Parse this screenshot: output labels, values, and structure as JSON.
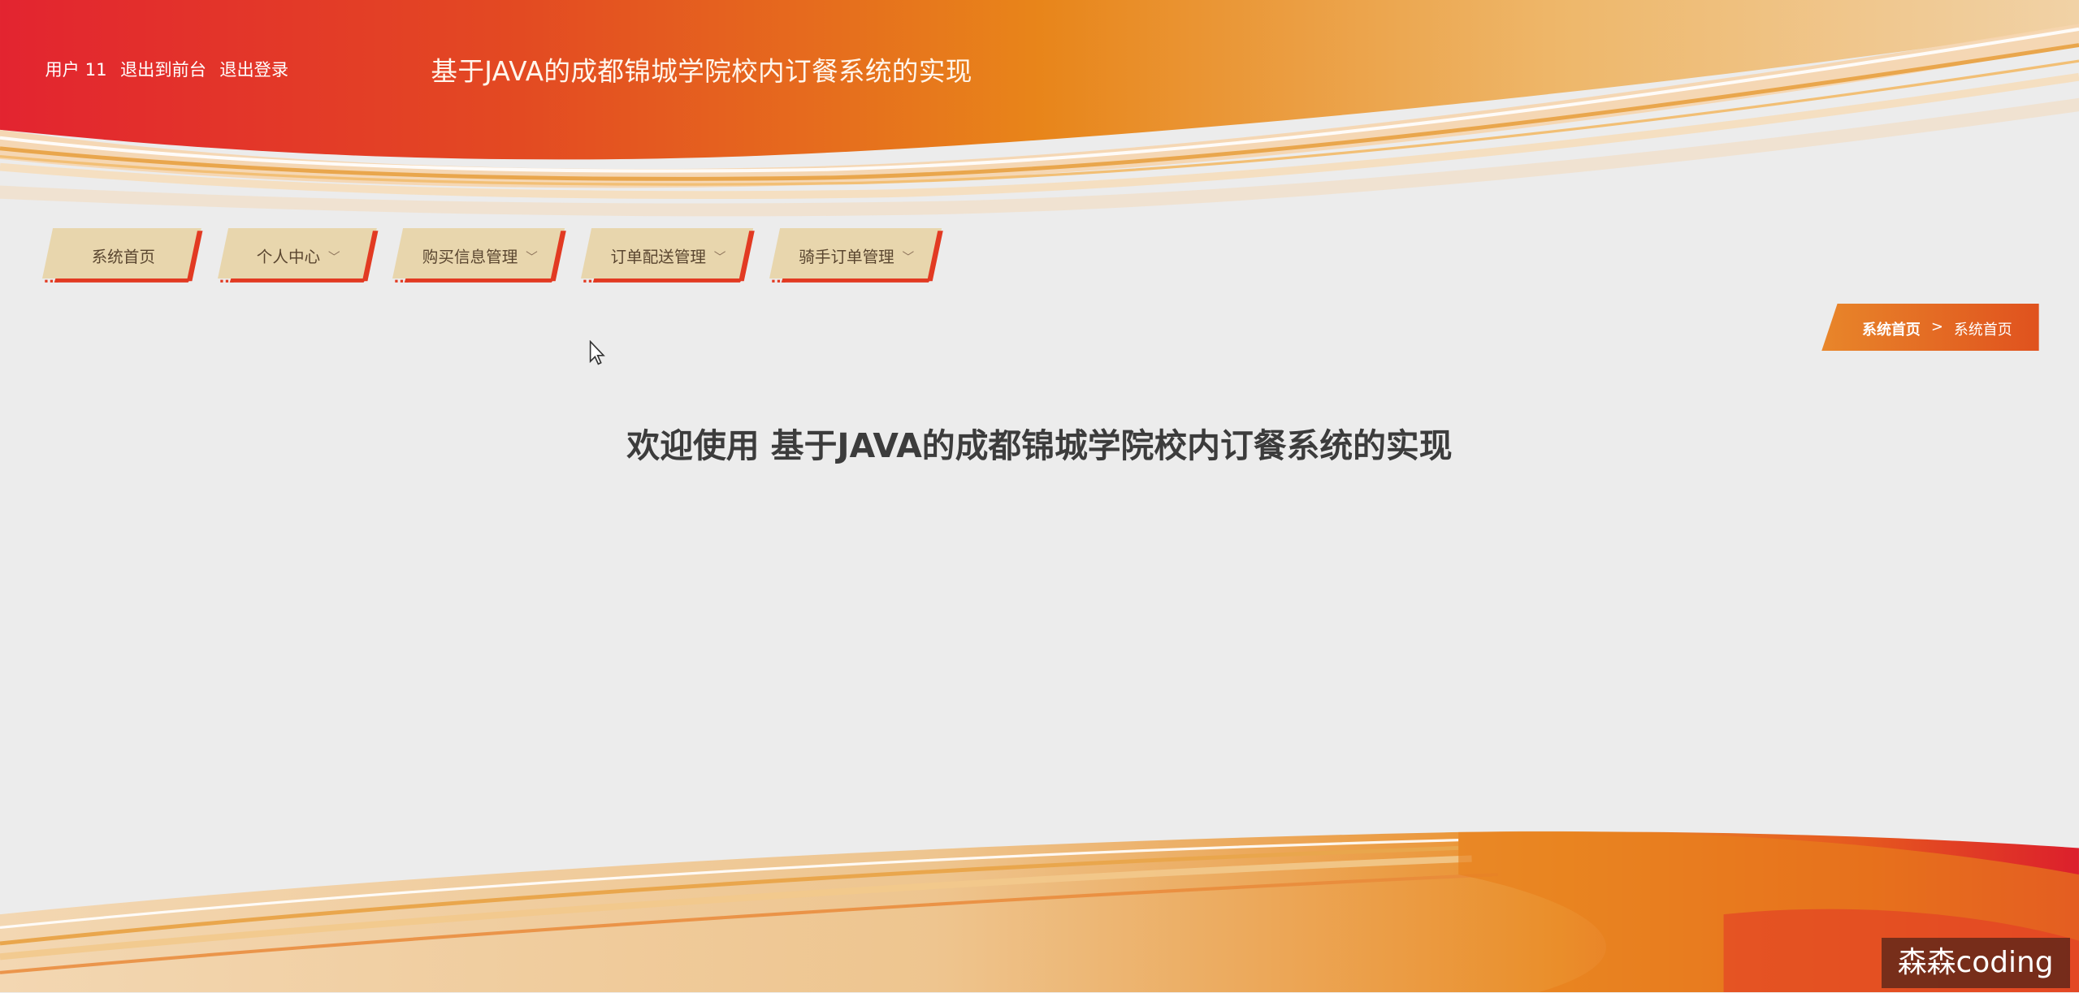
{
  "header": {
    "user_label": "用户 11",
    "links": [
      "退出到前台",
      "退出登录"
    ],
    "app_title": "基于JAVA的成都锦城学院校内订餐系统的实现"
  },
  "nav": {
    "items": [
      {
        "label": "系统首页",
        "has_dropdown": false
      },
      {
        "label": "个人中心",
        "has_dropdown": true
      },
      {
        "label": "购买信息管理",
        "has_dropdown": true
      },
      {
        "label": "订单配送管理",
        "has_dropdown": true
      },
      {
        "label": "骑手订单管理",
        "has_dropdown": true
      }
    ]
  },
  "breadcrumb": {
    "items": [
      "系统首页",
      "系统首页"
    ],
    "separator": ">"
  },
  "main": {
    "welcome": "欢迎使用 基于JAVA的成都锦城学院校内订餐系统的实现"
  },
  "watermark": "森森coding",
  "colors": {
    "primary_red": "#e02a2a",
    "accent_orange": "#e98a1a",
    "nav_tab_bg": "#e8d6ad",
    "background": "#ececec"
  }
}
